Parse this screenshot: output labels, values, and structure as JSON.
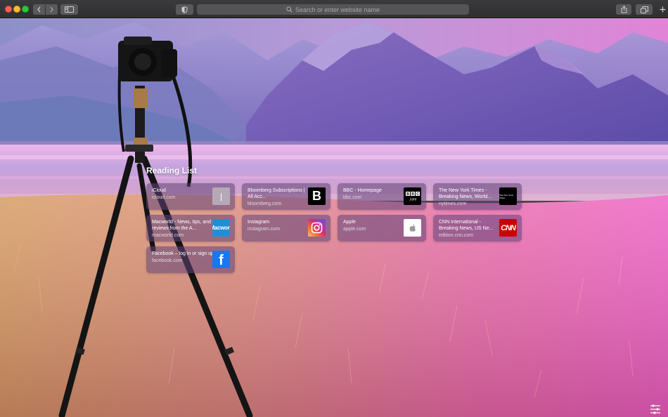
{
  "toolbar": {
    "address_placeholder": "Search or enter website name",
    "icons": {
      "back": "chevron-left-icon",
      "forward": "chevron-right-icon",
      "sidebar": "sidebar-icon",
      "privacy": "shield-icon",
      "search": "search-icon",
      "share": "share-icon",
      "tabs": "tabs-icon",
      "new_tab": "plus-icon"
    }
  },
  "reading_list": {
    "title": "Reading List",
    "items": [
      {
        "title": "iCloud",
        "domain": "icloud.com",
        "icon": "icloud-icon",
        "icon_text": "|"
      },
      {
        "title": "Bloomberg Subscriptions | All Acc...",
        "domain": "bloomberg.com",
        "icon": "bloomberg-icon",
        "icon_text": "B"
      },
      {
        "title": "BBC - Homepage",
        "domain": "bbc.com",
        "icon": "bbc-icon",
        "icon_text": "BBC.com"
      },
      {
        "title": "The New York Times - Breaking News, World...",
        "domain": "nytimes.com",
        "icon": "nytimes-icon",
        "icon_text": "The New York Times"
      },
      {
        "title": "Macworld - News, tips, and reviews from the A...",
        "domain": "macworld.com",
        "icon": "macworld-icon",
        "icon_text": "Macwork"
      },
      {
        "title": "Instagram",
        "domain": "instagram.com",
        "icon": "instagram-icon",
        "icon_text": ""
      },
      {
        "title": "Apple",
        "domain": "apple.com",
        "icon": "apple-icon",
        "icon_text": ""
      },
      {
        "title": "CNN International - Breaking News, US Ne...",
        "domain": "edition.cnn.com",
        "icon": "cnn-icon",
        "icon_text": "CNN"
      },
      {
        "title": "Facebook – log in or sign up",
        "domain": "facebook.com",
        "icon": "facebook-icon",
        "icon_text": "f"
      }
    ]
  },
  "colors": {
    "toolbar_bg": "#333335",
    "address_bg": "#545456",
    "card_bg": "#604276",
    "sky": "#c28fd6",
    "grass": "#e07a7a"
  },
  "bottom_right": {
    "icon": "settings-sliders-icon"
  }
}
